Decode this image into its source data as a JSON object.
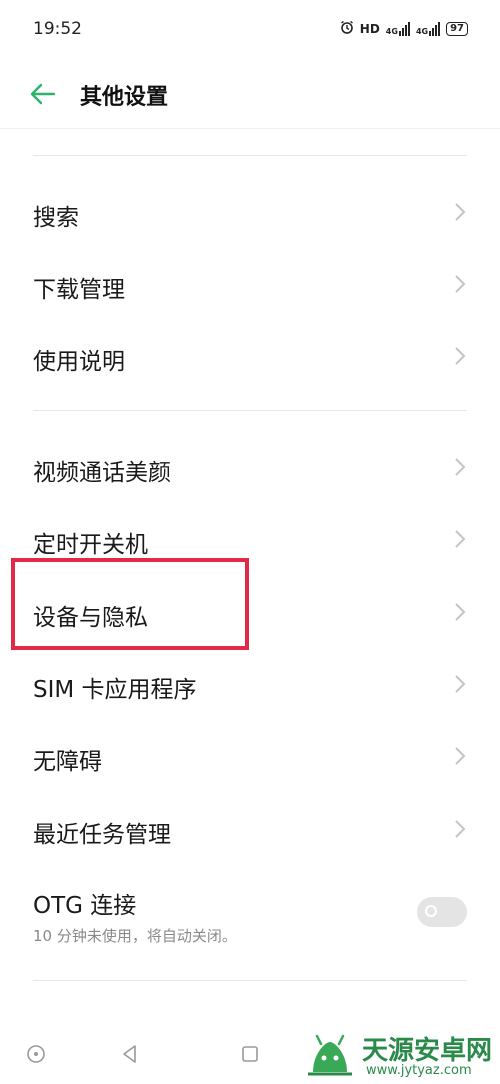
{
  "status_bar": {
    "time": "19:52",
    "network_label": "HD",
    "signal_label": "4G",
    "battery": "97"
  },
  "header": {
    "back_icon": "arrow-left-icon",
    "title": "其他设置",
    "accent_color": "#2fb36b"
  },
  "menu": {
    "items": [
      {
        "label": "搜索"
      },
      {
        "label": "下载管理"
      },
      {
        "label": "使用说明"
      },
      {
        "label": "视频通话美颜"
      },
      {
        "label": "定时开关机"
      },
      {
        "label": "设备与隐私"
      },
      {
        "label": "SIM 卡应用程序"
      },
      {
        "label": "无障碍"
      },
      {
        "label": "最近任务管理"
      }
    ],
    "otg": {
      "label": "OTG 连接",
      "description": "10 分钟未使用，将自动关闭。",
      "enabled": false
    }
  },
  "highlight_color": "#e02a47",
  "navbar": {
    "icons": [
      "circle-icon",
      "back-triangle-icon",
      "square-icon"
    ]
  },
  "watermark": {
    "title": "天源安卓网",
    "url": "www.jytyaz.com"
  }
}
